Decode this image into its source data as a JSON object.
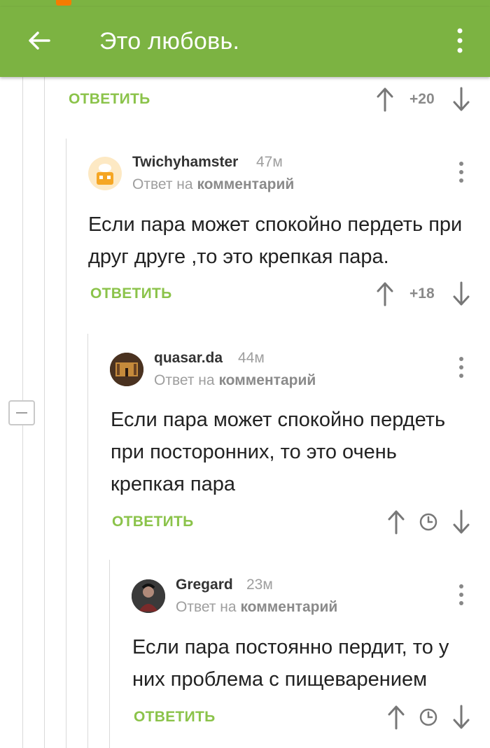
{
  "appbar": {
    "title": "Это любовь."
  },
  "top_actions": {
    "reply_label": "ОТВЕТИТЬ",
    "score": "+20"
  },
  "comments": [
    {
      "author": "Twichyhamster",
      "time": "47м",
      "reply_prefix": "Ответ на",
      "reply_target": "комментарий",
      "body": "Если пара может спокойно пердеть при друг друге ,то это крепкая пара.",
      "reply_label": "ОТВЕТИТЬ",
      "score": "+18"
    },
    {
      "author": "quasar.da",
      "time": "44м",
      "reply_prefix": "Ответ на",
      "reply_target": "комментарий",
      "body": "Если пара может спокойно пердеть при посторонних, то это очень крепкая пара",
      "reply_label": "ОТВЕТИТЬ",
      "score_icon": "clock-icon"
    },
    {
      "author": "Gregard",
      "time": "23м",
      "reply_prefix": "Ответ на",
      "reply_target": "комментарий",
      "body": "Если пара постоянно пердит, то у них проблема с пищеварением",
      "reply_label": "ОТВЕТИТЬ",
      "score_icon": "clock-icon"
    }
  ],
  "colors": {
    "accent": "#7cb342",
    "reply": "#8bc34a",
    "muted": "#9e9e9e"
  }
}
